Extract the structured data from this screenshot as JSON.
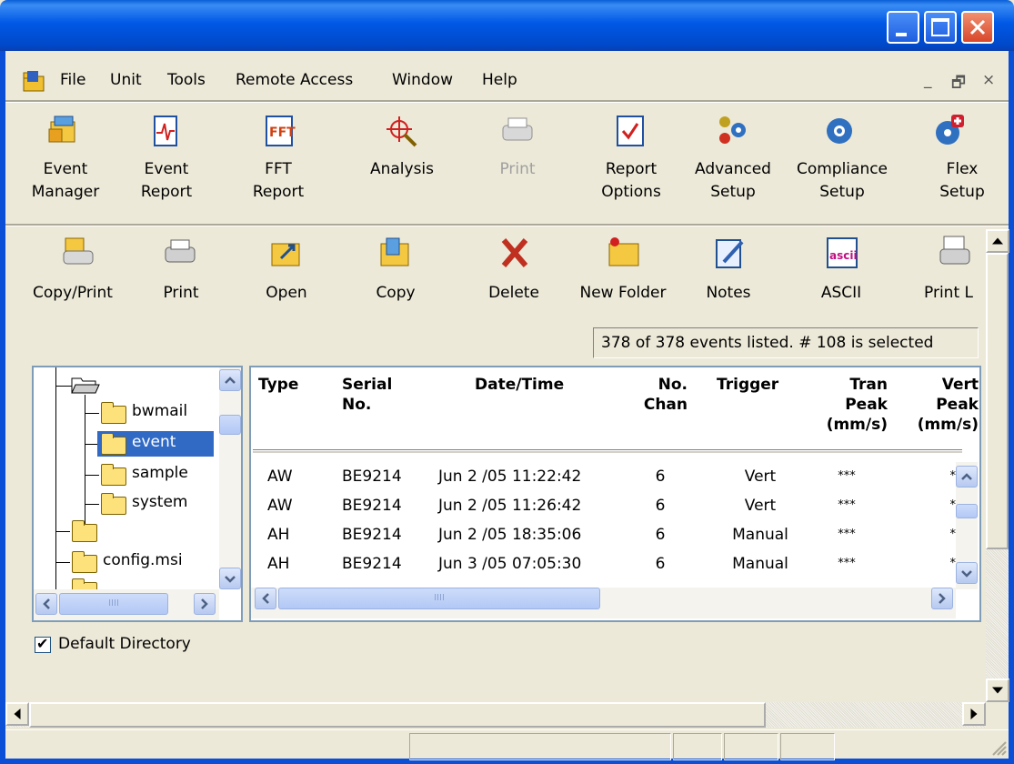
{
  "window": {
    "title": ""
  },
  "menubar": {
    "items": [
      "File",
      "Unit",
      "Tools",
      "Remote Access",
      "Window",
      "Help"
    ],
    "mdi_controls": [
      "_",
      "🗗",
      "×"
    ]
  },
  "toolbar_main": [
    {
      "label": "Event\nManager",
      "icon": "event-manager-icon",
      "enabled": true
    },
    {
      "label": "Event\nReport",
      "icon": "event-report-icon",
      "enabled": true
    },
    {
      "label": "FFT\nReport",
      "icon": "fft-report-icon",
      "enabled": true
    },
    {
      "label": "Analysis",
      "icon": "analysis-icon",
      "enabled": true
    },
    {
      "label": "Print",
      "icon": "printer-icon",
      "enabled": false
    },
    {
      "label": "Report\nOptions",
      "icon": "report-options-icon",
      "enabled": true
    },
    {
      "label": "Advanced\nSetup",
      "icon": "advanced-setup-icon",
      "enabled": true
    },
    {
      "label": "Compliance\nSetup",
      "icon": "compliance-setup-icon",
      "enabled": true
    },
    {
      "label": "Flex\nSetup",
      "icon": "flex-setup-icon",
      "enabled": true
    }
  ],
  "toolbar_files": [
    {
      "label": "Copy/Print",
      "icon": "copy-print-icon"
    },
    {
      "label": "Print",
      "icon": "printer-icon"
    },
    {
      "label": "Open",
      "icon": "open-folder-icon"
    },
    {
      "label": "Copy",
      "icon": "copy-folder-icon"
    },
    {
      "label": "Delete",
      "icon": "delete-x-icon"
    },
    {
      "label": "New Folder",
      "icon": "new-folder-icon"
    },
    {
      "label": "Notes",
      "icon": "notes-icon"
    },
    {
      "label": "ASCII",
      "icon": "ascii-icon"
    },
    {
      "label": "Print L",
      "icon": "print-list-icon"
    }
  ],
  "status": "378 of 378 events listed. # 108 is selected",
  "tree": {
    "items": [
      {
        "label": "bwmail",
        "selected": false
      },
      {
        "label": "event",
        "selected": true
      },
      {
        "label": "sample",
        "selected": false
      },
      {
        "label": "system",
        "selected": false
      },
      {
        "label": "",
        "selected": false
      },
      {
        "label": "config.msi",
        "selected": false
      }
    ]
  },
  "table": {
    "headers": [
      [
        "Type"
      ],
      [
        "Serial",
        "No."
      ],
      [
        "Date/Time"
      ],
      [
        "No.",
        "Chan"
      ],
      [
        "Trigger"
      ],
      [
        "Tran",
        "Peak",
        "(mm/s)"
      ],
      [
        "Vert",
        "Peak",
        "(mm/s)"
      ]
    ],
    "rows": [
      [
        "AW",
        "BE9214",
        "Jun 2 /05  11:22:42",
        "6",
        "Vert",
        "***",
        "***"
      ],
      [
        "AW",
        "BE9214",
        "Jun 2 /05  11:26:42",
        "6",
        "Vert",
        "***",
        "***"
      ],
      [
        "AH",
        "BE9214",
        "Jun 2 /05  18:35:06",
        "6",
        "Manual",
        "***",
        "***"
      ],
      [
        "AH",
        "BE9214",
        "Jun 3 /05  07:05:30",
        "6",
        "Manual",
        "***",
        "***"
      ]
    ]
  },
  "default_directory": {
    "label": "Default Directory",
    "checked": true,
    "check_mark": "✔"
  },
  "tree_hscroll_grip": "IIII",
  "list_hscroll_grip": "IIII"
}
